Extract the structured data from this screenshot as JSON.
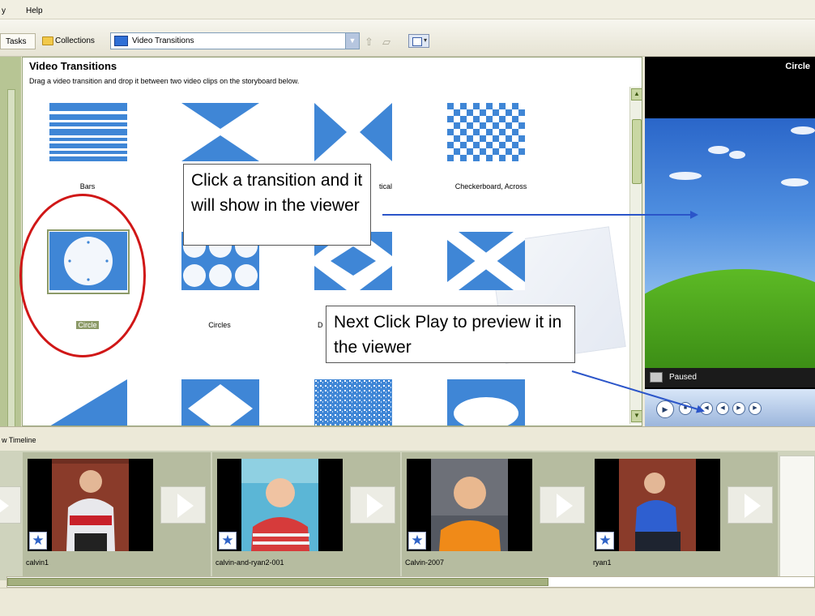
{
  "menu": {
    "view_partial": "y",
    "help": "Help"
  },
  "toolbar": {
    "tasks": "Tasks",
    "collections": "Collections",
    "collection_select": "Video Transitions"
  },
  "panel": {
    "title": "Video Transitions",
    "subtitle": "Drag a video transition and drop it between two video clips on the storyboard below.",
    "items": [
      {
        "label": "Bars",
        "icon": "bars-transition-icon"
      },
      {
        "label": "",
        "icon": "bow-tie-horizontal-icon"
      },
      {
        "label": "tical",
        "icon": "bow-tie-vertical-icon"
      },
      {
        "label": "Checkerboard, Across",
        "icon": "checkerboard-icon"
      },
      {
        "label": "Circle",
        "icon": "circle-transition-icon",
        "selected": true
      },
      {
        "label": "Circles",
        "icon": "circles-transition-icon"
      },
      {
        "label": "D",
        "icon": "diamond-transition-icon"
      },
      {
        "label": "",
        "icon": "diagonal-cross-icon"
      },
      {
        "label": "",
        "icon": "diagonal-box-icon"
      },
      {
        "label": "",
        "icon": "diamond-out-icon"
      },
      {
        "label": "",
        "icon": "dissolve-icon"
      },
      {
        "label": "",
        "icon": "eye-transition-icon"
      }
    ]
  },
  "callouts": {
    "first": "Click a transition and it will show in the viewer",
    "second": "Next Click Play to preview it in the viewer"
  },
  "preview": {
    "title": "Circle",
    "status": "Paused"
  },
  "timeline": {
    "label": "w Timeline",
    "clips": [
      {
        "name": "calvin1"
      },
      {
        "name": "calvin-and-ryan2-001"
      },
      {
        "name": "Calvin-2007"
      },
      {
        "name": "ryan1"
      }
    ]
  },
  "colors": {
    "transition_blue": "#3f86d6",
    "highlight_red": "#d01717",
    "panel_border": "#98a57a"
  }
}
